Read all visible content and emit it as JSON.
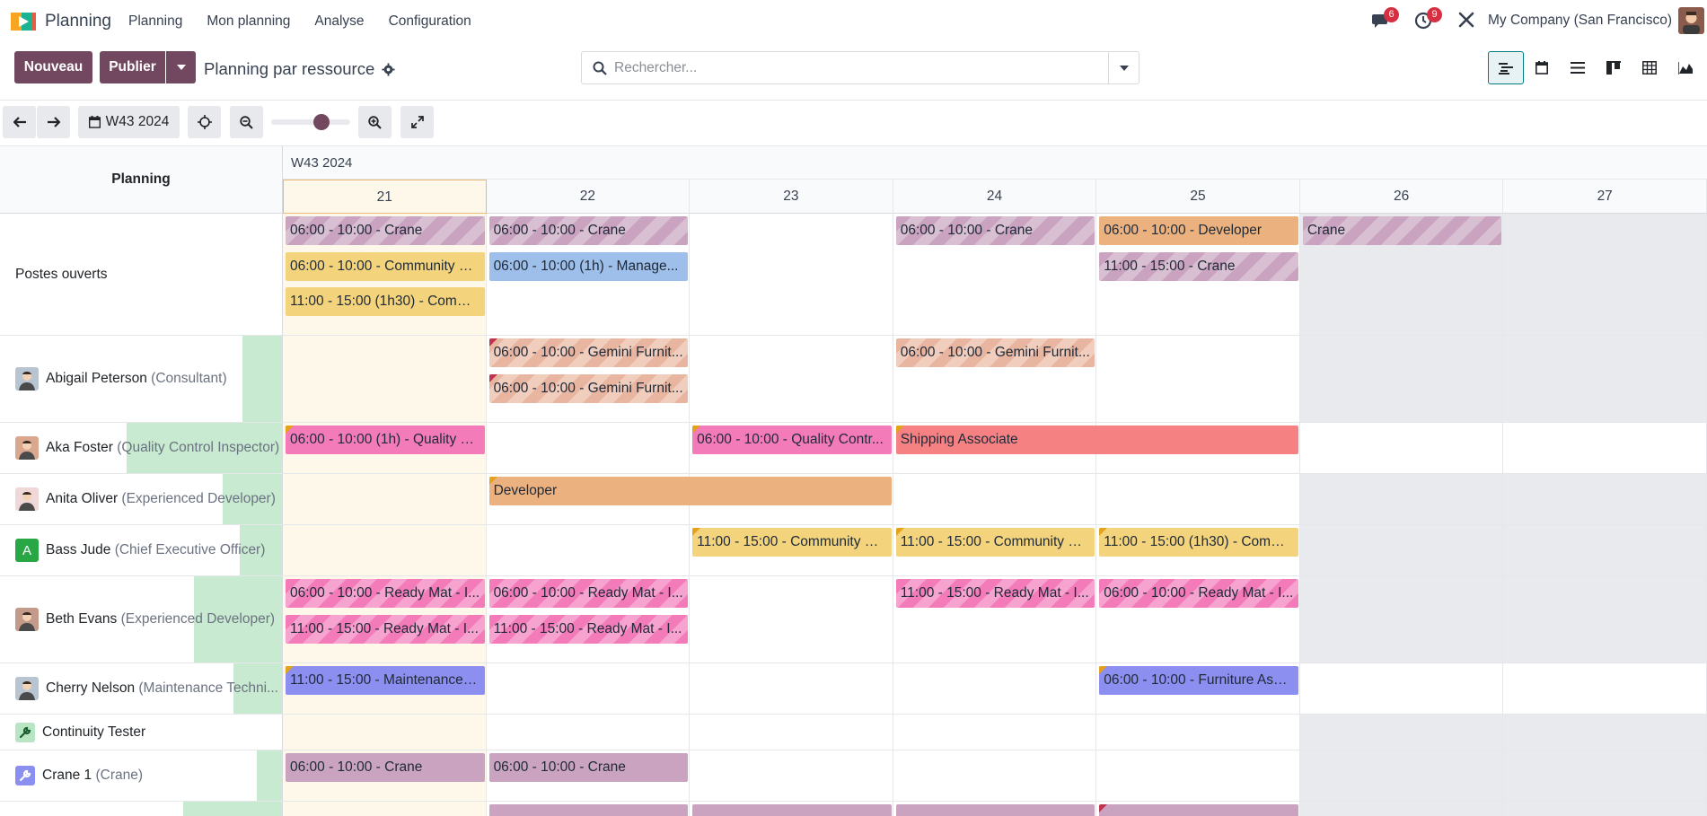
{
  "navbar": {
    "app_name": "Planning",
    "menu": [
      "Planning",
      "Mon planning",
      "Analyse",
      "Configuration"
    ],
    "messages_badge": "6",
    "activities_badge": "9",
    "company": "My Company (San Francisco)"
  },
  "control": {
    "new_label": "Nouveau",
    "publish_label": "Publier",
    "breadcrumb": "Planning par ressource",
    "search_placeholder": "Rechercher..."
  },
  "toolbar": {
    "week_label": "W43 2024",
    "zoom_level": 0.55
  },
  "gantt": {
    "left_header": "Planning",
    "week_header": "W43 2024",
    "days": [
      "21",
      "22",
      "23",
      "24",
      "25",
      "26",
      "27"
    ],
    "rows": [
      {
        "name": "Postes ouverts",
        "job": "",
        "avatar": "none",
        "pills": [
          {
            "day": 0,
            "span": 1,
            "line": 0,
            "text": "06:00 - 10:00 - Crane",
            "color": "c-crane-s"
          },
          {
            "day": 0,
            "span": 1,
            "line": 1,
            "text": "06:00 - 10:00 - Community M...",
            "color": "c-yellow"
          },
          {
            "day": 0,
            "span": 1,
            "line": 2,
            "text": "11:00 - 15:00 (1h30) - Comm...",
            "color": "c-yellow"
          },
          {
            "day": 1,
            "span": 1,
            "line": 0,
            "text": "06:00 - 10:00 - Crane",
            "color": "c-crane-s"
          },
          {
            "day": 1,
            "span": 1,
            "line": 1,
            "text": "06:00 - 10:00 (1h) - Manage...",
            "color": "c-blue"
          },
          {
            "day": 3,
            "span": 1,
            "line": 0,
            "text": "06:00 - 10:00 - Crane",
            "color": "c-crane-s"
          },
          {
            "day": 4,
            "span": 1,
            "line": 0,
            "text": "06:00 - 10:00 - Developer",
            "color": "c-orange"
          },
          {
            "day": 4,
            "span": 1,
            "line": 1,
            "text": "11:00 - 15:00 - Crane",
            "color": "c-crane-s"
          },
          {
            "day": 5,
            "span": 1,
            "line": 0,
            "text": "Crane",
            "color": "c-crane-s"
          }
        ]
      },
      {
        "name": "Abigail Peterson",
        "job": "(Consultant)",
        "avatar": "person",
        "fill": 0.14,
        "pills": [
          {
            "day": 1,
            "span": 1,
            "line": 0,
            "text": "06:00 - 10:00 - Gemini Furnit...",
            "color": "c-salmon-s",
            "corner": "red"
          },
          {
            "day": 1,
            "span": 1,
            "line": 1,
            "text": "06:00 - 10:00 - Gemini Furnit...",
            "color": "c-salmon-s",
            "corner": "red"
          },
          {
            "day": 3,
            "span": 1,
            "line": 0,
            "text": "06:00 - 10:00 - Gemini Furnit...",
            "color": "c-salmon-s"
          }
        ]
      },
      {
        "name": "Aka Foster",
        "job": "(Quality Control Inspector)",
        "avatar": "person",
        "fill": 0.55,
        "pills": [
          {
            "day": 0,
            "span": 1,
            "line": 0,
            "text": "06:00 - 10:00 (1h) - Quality C...",
            "color": "c-pink",
            "corner": "yellow"
          },
          {
            "day": 2,
            "span": 1,
            "line": 0,
            "text": "06:00 - 10:00 - Quality Contr...",
            "color": "c-pink",
            "corner": "yellow"
          },
          {
            "day": 3,
            "span": 2,
            "line": 0,
            "text": "Shipping Associate",
            "color": "c-red",
            "corner": "yellow"
          }
        ]
      },
      {
        "name": "Anita Oliver",
        "job": "(Experienced Developer)",
        "avatar": "person",
        "fill": 0.21,
        "pills": [
          {
            "day": 1,
            "span": 2,
            "line": 0,
            "text": "Developer",
            "color": "c-orange",
            "corner": "yellow"
          }
        ]
      },
      {
        "name": "Bass Jude",
        "job": "(Chief Executive Officer)",
        "avatar": "letter",
        "letter": "A",
        "fill": 0.15,
        "pills": [
          {
            "day": 2,
            "span": 1,
            "line": 0,
            "text": "11:00 - 15:00 - Community M...",
            "color": "c-yellow",
            "corner": "yellow"
          },
          {
            "day": 3,
            "span": 1,
            "line": 0,
            "text": "11:00 - 15:00 - Community M...",
            "color": "c-yellow",
            "corner": "yellow"
          },
          {
            "day": 4,
            "span": 1,
            "line": 0,
            "text": "11:00 - 15:00 (1h30) - Comm...",
            "color": "c-yellow",
            "corner": "yellow"
          }
        ]
      },
      {
        "name": "Beth Evans",
        "job": "(Experienced Developer)",
        "avatar": "person",
        "fill": 0.31,
        "pills": [
          {
            "day": 0,
            "span": 1,
            "line": 0,
            "text": "06:00 - 10:00 - Ready Mat - I...",
            "color": "c-pink-s"
          },
          {
            "day": 0,
            "span": 1,
            "line": 1,
            "text": "11:00 - 15:00 - Ready Mat - I...",
            "color": "c-pink-s"
          },
          {
            "day": 1,
            "span": 1,
            "line": 0,
            "text": "06:00 - 10:00 - Ready Mat - I...",
            "color": "c-pink-s"
          },
          {
            "day": 1,
            "span": 1,
            "line": 1,
            "text": "11:00 - 15:00 - Ready Mat - I...",
            "color": "c-pink-s"
          },
          {
            "day": 3,
            "span": 1,
            "line": 0,
            "text": "11:00 - 15:00 - Ready Mat - I...",
            "color": "c-pink-s"
          },
          {
            "day": 4,
            "span": 1,
            "line": 0,
            "text": "06:00 - 10:00 - Ready Mat - I...",
            "color": "c-pink-s"
          }
        ]
      },
      {
        "name": "Cherry Nelson",
        "job": "(Maintenance Techni...",
        "avatar": "person",
        "fill": 0.17,
        "pills": [
          {
            "day": 0,
            "span": 1,
            "line": 0,
            "text": "11:00 - 15:00 - Maintenance T...",
            "color": "c-indigo",
            "corner": "yellow"
          },
          {
            "day": 4,
            "span": 1,
            "line": 0,
            "text": "06:00 - 10:00 - Furniture Asse...",
            "color": "c-indigo",
            "corner": "yellow"
          }
        ]
      },
      {
        "name": "Continuity Tester",
        "job": "",
        "avatar": "wrench",
        "fill": 0.0,
        "pills": []
      },
      {
        "name": "Crane 1",
        "job": "(Crane)",
        "avatar": "wrench-blue",
        "fill": 0.09,
        "pills": [
          {
            "day": 0,
            "span": 1,
            "line": 0,
            "text": "06:00 - 10:00 - Crane",
            "color": "c-crane"
          },
          {
            "day": 1,
            "span": 1,
            "line": 0,
            "text": "06:00 - 10:00 - Crane",
            "color": "c-crane"
          }
        ]
      },
      {
        "name": "",
        "job": "",
        "avatar": "none",
        "fill": 0.35,
        "pills": [
          {
            "day": 1,
            "span": 1,
            "line": 0,
            "text": "",
            "color": "c-crane"
          },
          {
            "day": 2,
            "span": 1,
            "line": 0,
            "text": "",
            "color": "c-crane"
          },
          {
            "day": 3,
            "span": 1,
            "line": 0,
            "text": "",
            "color": "c-crane"
          },
          {
            "day": 4,
            "span": 1,
            "line": 0,
            "text": "",
            "color": "c-crane",
            "corner": "red"
          }
        ]
      }
    ]
  }
}
